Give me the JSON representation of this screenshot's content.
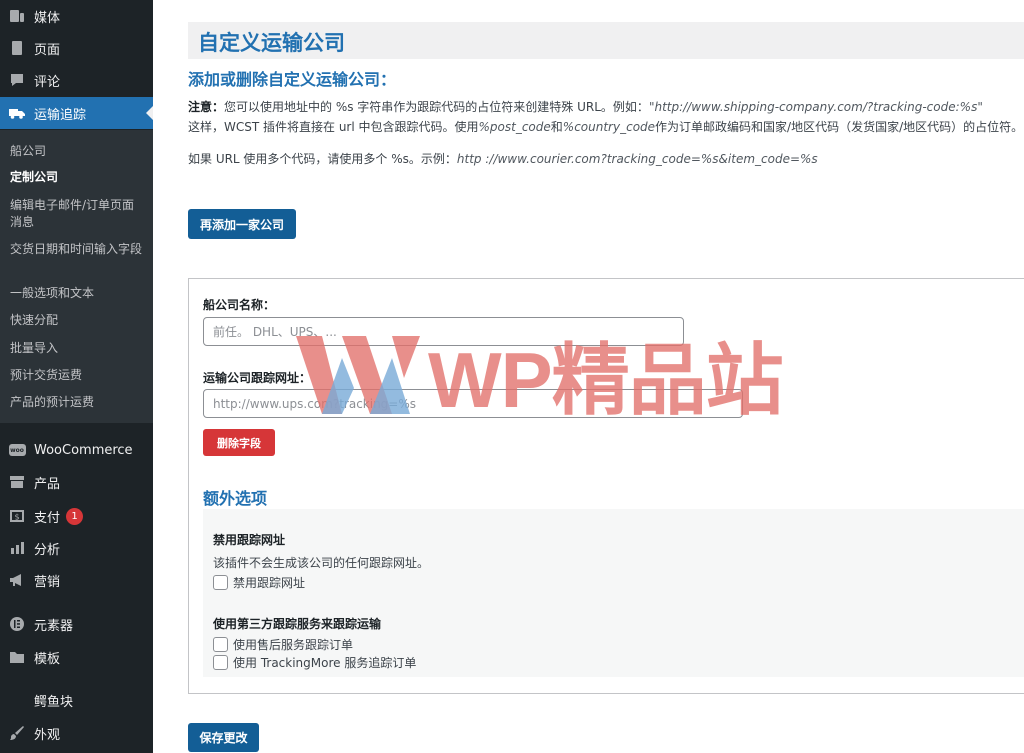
{
  "sidebar": {
    "menu": [
      {
        "label": "媒体",
        "icon": "media-icon"
      },
      {
        "label": "页面",
        "icon": "pages-icon"
      },
      {
        "label": "评论",
        "icon": "comments-icon"
      },
      {
        "label": "运输追踪",
        "icon": "truck-icon"
      },
      {
        "label": "WooCommerce",
        "icon": "woocommerce-icon"
      },
      {
        "label": "产品",
        "icon": "archive-icon"
      },
      {
        "label": "支付",
        "icon": "dollar-icon",
        "badge": "1"
      },
      {
        "label": "分析",
        "icon": "chart-bars-icon"
      },
      {
        "label": "营销",
        "icon": "megaphone-icon"
      },
      {
        "label": "元素器",
        "icon": "elementor-icon"
      },
      {
        "label": "模板",
        "icon": "folder-icon"
      },
      {
        "label": "鳄鱼块",
        "icon": "crescent-icon"
      },
      {
        "label": "外观",
        "icon": "paintbrush-icon"
      }
    ],
    "submenu": [
      "船公司",
      "定制公司",
      "编辑电子邮件/订单页面消息",
      "交货日期和时间输入字段",
      "一般选项和文本",
      "快速分配",
      "批量导入",
      "预计交货运费",
      "产品的预计运费"
    ]
  },
  "main": {
    "page_title": "自定义运输公司",
    "section_title": "添加或删除自定义运输公司：",
    "note_label": "注意：",
    "note_line1_text": "您可以使用地址中的 %s 字符串作为跟踪代码的占位符来创建特殊 URL。例如：",
    "note_line1_example": "\"http://www.shipping-company.com/?tracking-code:%s\"",
    "note_line2_a": "这样，WCST 插件将直接在 url 中包含跟踪代码。使用",
    "note_line2_code1": "%post_code",
    "note_line2_b": "和",
    "note_line2_code2": "%country_code",
    "note_line2_c": "作为订单邮政编码和国家/地区代码（发货国家/地区代码）的占位符。",
    "note_line3_text": "如果 URL 使用多个代码，请使用多个 %s。示例：",
    "note_line3_example": "http ://www.courier.com?tracking_code=%s&item_code=%s",
    "add_button": "再添加一家公司",
    "company_name_label": "船公司名称：",
    "company_name_placeholder": "前任。 DHL、UPS、...",
    "tracking_url_label": "运输公司跟踪网址：",
    "tracking_url_placeholder": "http://www.ups.com?tracking=%s",
    "delete_button": "删除字段",
    "extra_title": "额外选项",
    "disable_heading": "禁用跟踪网址",
    "disable_desc": "该插件不会生成该公司的任何跟踪网址。",
    "disable_checkbox": "禁用跟踪网址",
    "third_party_heading": "使用第三方跟踪服务来跟踪运输",
    "third_party_option1": "使用售后服务跟踪订单",
    "third_party_option2": "使用 TrackingMore 服务追踪订单",
    "save_button": "保存更改"
  },
  "watermark": "WP精品站",
  "colors": {
    "sidebar_bg": "#1d2327",
    "submenu_bg": "#2c3338",
    "accent": "#2271b1",
    "primary_button": "#135e96",
    "danger": "#d63638",
    "watermark": "#e2706a"
  }
}
